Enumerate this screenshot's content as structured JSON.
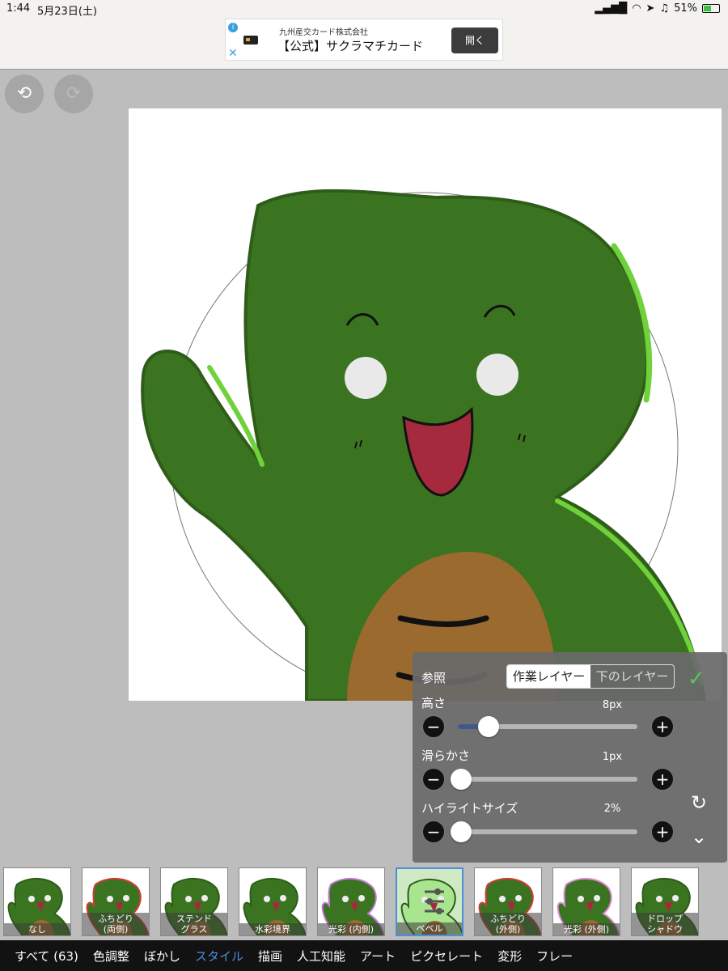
{
  "status": {
    "time": "1:44",
    "date": "5月23日(土)",
    "battery": "51%",
    "battery_level": 0.51
  },
  "ad": {
    "sponsor": "九州産交カード株式会社",
    "headline": "【公式】サクラマチカード",
    "button": "開く",
    "info_icon": "i",
    "close_icon": "✕"
  },
  "toolbar": {
    "undo_icon": "⟲",
    "redo_icon": "⟳"
  },
  "panel": {
    "reference_label": "参照",
    "segment_on": "作業レイヤー",
    "segment_off": "下のレイヤー",
    "confirm_icon": "✓",
    "reset_icon": "↻",
    "collapse_icon": "⌄",
    "minus": "−",
    "plus": "+",
    "sliders": [
      {
        "label": "高さ",
        "value": "8px",
        "fraction": 0.17
      },
      {
        "label": "滑らかさ",
        "value": "1px",
        "fraction": 0.02
      },
      {
        "label": "ハイライトサイズ",
        "value": "2%",
        "fraction": 0.02
      }
    ]
  },
  "thumbnails": [
    {
      "label": "なし"
    },
    {
      "label": "ふちどり\n(両側)"
    },
    {
      "label": "ステンド\nグラス"
    },
    {
      "label": "水彩境界"
    },
    {
      "label": "光彩 (内側)"
    },
    {
      "label": "ベベル",
      "selected": true
    },
    {
      "label": "ふちどり\n(外側)"
    },
    {
      "label": "光彩 (外側)"
    },
    {
      "label": "ドロップ\nシャドウ"
    }
  ],
  "tabs": [
    {
      "label": "すべて (63)"
    },
    {
      "label": "色調整"
    },
    {
      "label": "ぼかし"
    },
    {
      "label": "スタイル",
      "active": true
    },
    {
      "label": "描画"
    },
    {
      "label": "人工知能"
    },
    {
      "label": "アート"
    },
    {
      "label": "ピクセレート"
    },
    {
      "label": "変形"
    },
    {
      "label": "フレー"
    }
  ],
  "colors": {
    "body_green": "#3b7420",
    "highlight_green": "#6fd23a",
    "belly": "#9b6a2f",
    "mouth": "#a52a3e",
    "accent_blue": "#4c8fe0"
  }
}
